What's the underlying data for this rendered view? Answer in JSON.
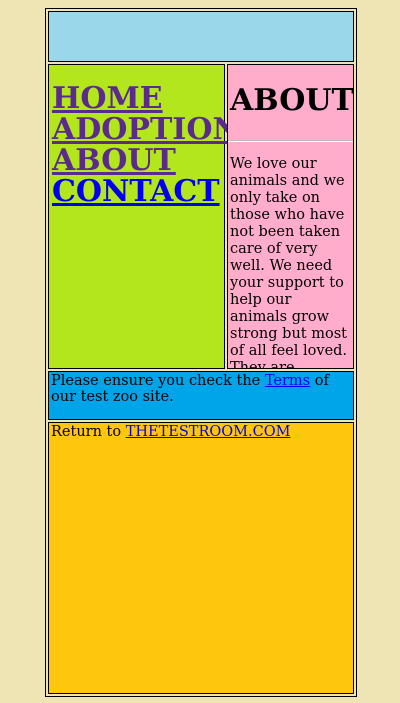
{
  "nav": {
    "items": [
      {
        "label": "HOME"
      },
      {
        "label": "ADOPTION"
      },
      {
        "label": "ABOUT"
      },
      {
        "label": "CONTACT"
      }
    ]
  },
  "about": {
    "heading": "ABOUT",
    "body": "We love our animals and we only take on those who have not been taken care of very well. We need your support to help our animals grow strong but most of all feel loved. They are waiting for you."
  },
  "notice": {
    "prefix": "Please ensure you check the ",
    "link_label": "Terms",
    "suffix": " of our test zoo site."
  },
  "footer": {
    "prefix": "Return to ",
    "link_label": "THETESTROOM.COM"
  },
  "colors": {
    "page_background": "#efe4b4",
    "header": "#9ad7ea",
    "nav": "#b4e61e",
    "about": "#ffadcb",
    "notice": "#00a4e8",
    "footer": "#ffc60e",
    "visited_link": "#5a2b8c",
    "link": "#0000ee"
  }
}
